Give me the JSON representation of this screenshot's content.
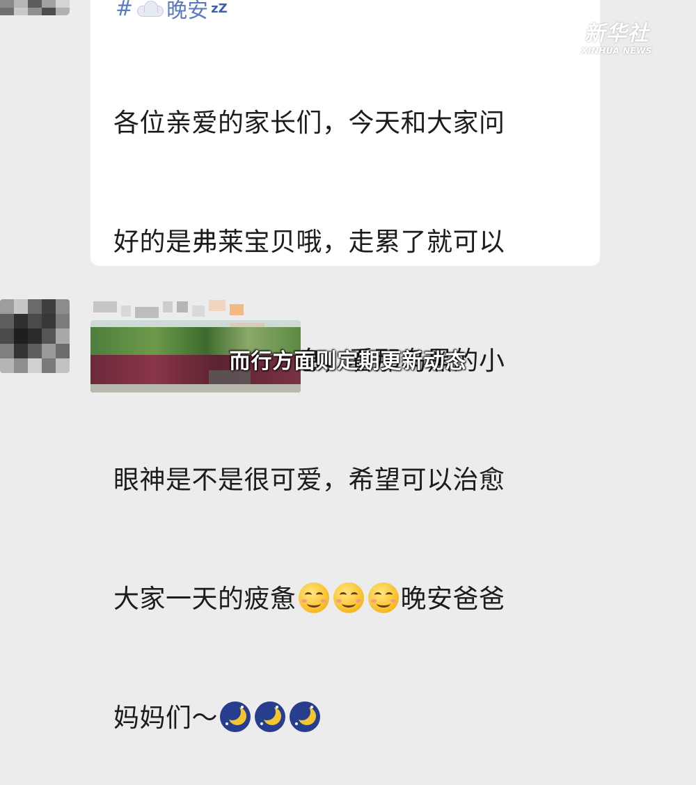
{
  "message": {
    "header_prefix": "#",
    "header_title": "晚安",
    "header_suffix": "zZ",
    "lines": {
      "l1": "各位亲爱的家长们，今天和大家问",
      "l2": "好的是弗莱宝贝哦，走累了就可以",
      "l3": "在长椅边休息休息，看那乌黑的小",
      "l4": "眼神是不是很可爱，希望可以治愈",
      "l5a": "大家一天的疲惫",
      "l5b": "晚安爸爸",
      "l6": "妈妈们～"
    },
    "emojis": {
      "smiles": [
        "smile-icon",
        "smile-icon",
        "smile-icon"
      ],
      "moons": [
        "moon-icon",
        "moon-icon",
        "moon-icon"
      ]
    }
  },
  "watermark": {
    "cn": "新华社",
    "en": "XINHUA NEWS"
  },
  "caption": {
    "text": "而行方面则定期更新动态"
  },
  "colors": {
    "background": "#ececec",
    "bubble": "#ffffff",
    "header_text": "#5a7bc0",
    "body_text": "#1c1c1c"
  }
}
